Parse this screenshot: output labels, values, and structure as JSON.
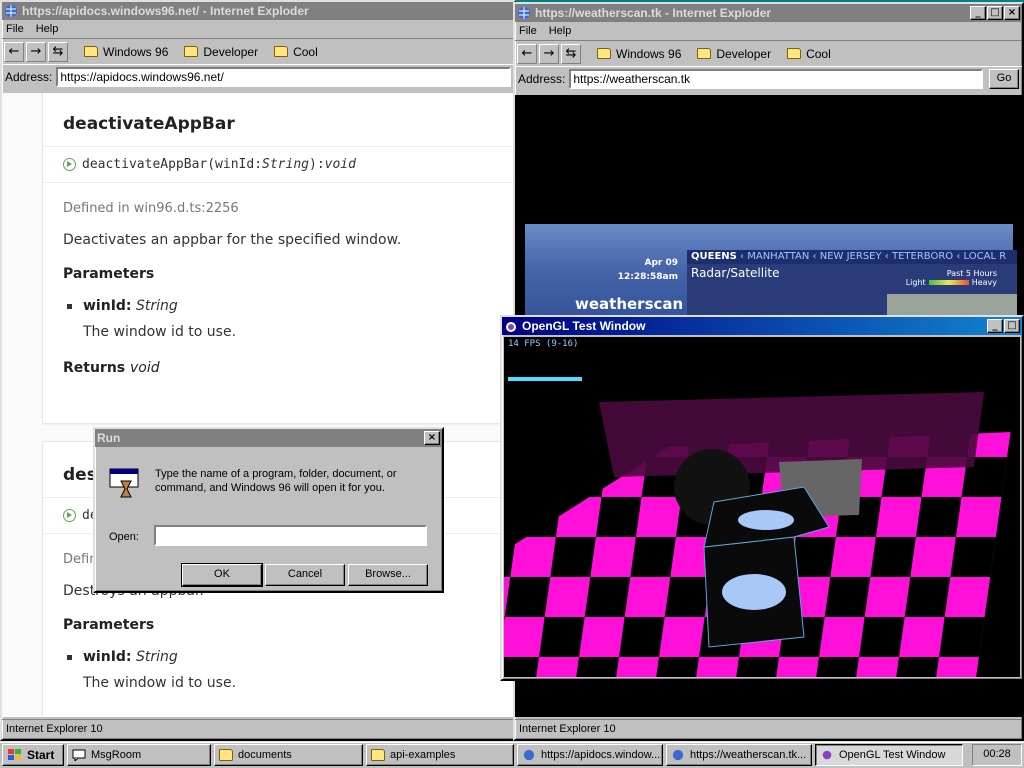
{
  "docs_window": {
    "title": "https://apidocs.windows96.net/ - Internet Exploder",
    "menu": [
      "File",
      "Help"
    ],
    "favorites": [
      "Windows 96",
      "Developer",
      "Cool"
    ],
    "address_label": "Address:",
    "address": "https://apidocs.windows96.net/",
    "status": "Internet Explorer 10",
    "content": {
      "card1": {
        "heading": "deactivateAppBar",
        "signature": {
          "name": "deactivateAppBar",
          "params": "(winId: ",
          "param_type": "String",
          "ret_sep": "): ",
          "ret_type": "void"
        },
        "defined_in": "Defined in win96.d.ts:2256",
        "description": "Deactivates an appbar for the specified window.",
        "params_heading": "Parameters",
        "param_name": "winId:",
        "param_type": "String",
        "param_desc": "The window id to use.",
        "returns_label": "Returns",
        "returns_type": "void"
      },
      "card2": {
        "heading": "dest",
        "signature": "de",
        "defined_in": "Defin",
        "description": "Destroys an appbar.",
        "params_heading": "Parameters",
        "param_name": "winId:",
        "param_type": "String",
        "param_desc": "The window id to use."
      }
    }
  },
  "weather_window": {
    "title": "https://weatherscan.tk - Internet Exploder",
    "menu": [
      "File",
      "Help"
    ],
    "favorites": [
      "Windows 96",
      "Developer",
      "Cool"
    ],
    "address_label": "Address:",
    "address": "https://weatherscan.tk",
    "go_label": "Go",
    "status": "Internet Explorer 10",
    "broadcast": {
      "date": "Apr 09",
      "time": "12:28:58am",
      "logo": "weatherscan",
      "regions_current": "QUEENS",
      "regions_other": [
        "MANHATTAN",
        "NEW JERSEY",
        "TETERBORO",
        "LOCAL R"
      ],
      "radar_title": "Radar/Satellite",
      "legend_title": "Past 5 Hours",
      "legend_light": "Light",
      "legend_heavy": "Heavy"
    }
  },
  "gl_window": {
    "title": "OpenGL Test Window",
    "fps": "14 FPS (9-16)",
    "colors": {
      "checker": "#ff10d8",
      "text3d": "#5a0a4a"
    }
  },
  "run_dialog": {
    "title": "Run",
    "prompt": "Type the name of a program, folder, document, or command, and Windows 96 will open it for you.",
    "open_label": "Open:",
    "open_value": "",
    "ok": "OK",
    "cancel": "Cancel",
    "browse": "Browse..."
  },
  "taskbar": {
    "start": "Start",
    "tasks": [
      "MsgRoom",
      "documents",
      "api-examples",
      "https://apidocs.window...",
      "https://weatherscan.tk...",
      "OpenGL Test Window"
    ],
    "clock": "00:28"
  }
}
